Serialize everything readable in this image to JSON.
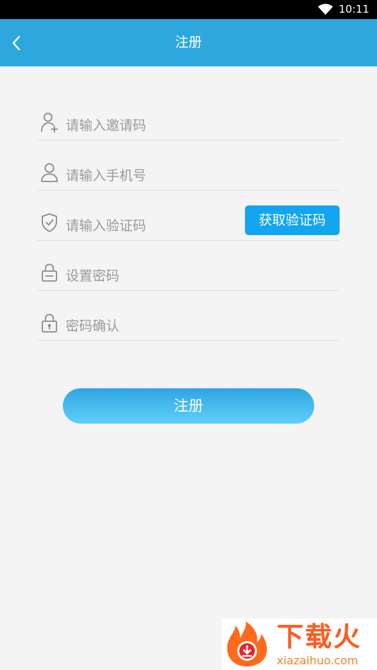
{
  "status_bar": {
    "time": "10:11",
    "wifi_icon": "wifi-icon"
  },
  "app_bar": {
    "title": "注册",
    "back_icon": "back-arrow-icon"
  },
  "form": {
    "invite_code": {
      "placeholder": "请输入邀请码",
      "value": "",
      "icon": "user-add-icon"
    },
    "phone": {
      "placeholder": "请输入手机号",
      "value": "",
      "icon": "user-icon"
    },
    "verify_code": {
      "placeholder": "请输入验证码",
      "value": "",
      "icon": "shield-check-icon"
    },
    "password": {
      "placeholder": "设置密码",
      "value": "",
      "icon": "lock-icon"
    },
    "confirm_password": {
      "placeholder": "密码确认",
      "value": "",
      "icon": "lock-keyhole-icon"
    },
    "get_code_label": "获取验证码",
    "submit_label": "注册"
  },
  "watermark": {
    "brand": "下载火",
    "domain": "xiazaihuo.com"
  },
  "colors": {
    "app_bar": "#2ea7df",
    "code_button": "#12a5f0",
    "submit_top": "#2fa5e1",
    "submit_bottom": "#5fd0f8",
    "background": "#f4f4f4"
  }
}
